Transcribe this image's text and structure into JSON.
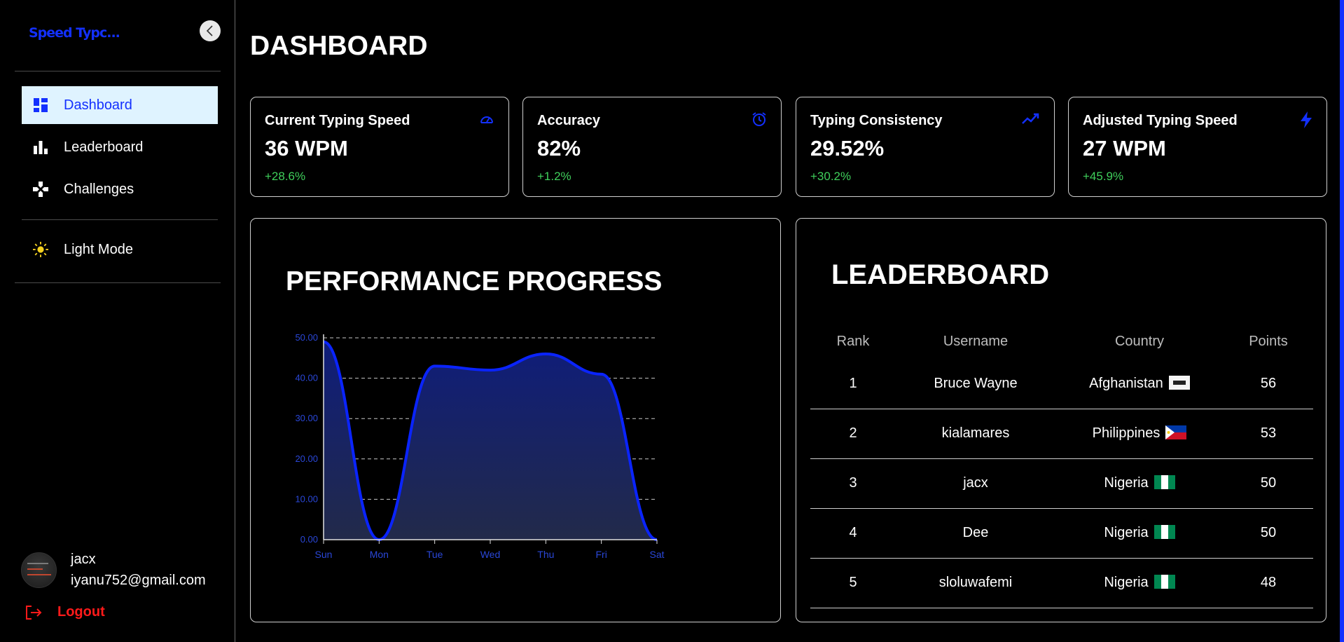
{
  "sidebar": {
    "brand": "Speed Typc...",
    "items": [
      {
        "label": "Dashboard",
        "icon": "dashboard-icon"
      },
      {
        "label": "Leaderboard",
        "icon": "bar-chart-icon"
      },
      {
        "label": "Challenges",
        "icon": "gamepad-icon"
      }
    ],
    "theme_toggle": "Light Mode",
    "user": {
      "name": "jacx",
      "email": "iyanu752@gmail.com"
    },
    "logout": "Logout"
  },
  "page_title": "DASHBOARD",
  "cards": [
    {
      "title": "Current Typing Speed",
      "value": "36 WPM",
      "delta": "+28.6%",
      "icon": "speedometer-icon"
    },
    {
      "title": "Accuracy",
      "value": "82%",
      "delta": "+1.2%",
      "icon": "alarm-clock-icon"
    },
    {
      "title": "Typing Consistency",
      "value": "29.52%",
      "delta": "+30.2%",
      "icon": "trending-up-icon"
    },
    {
      "title": "Adjusted Typing Speed",
      "value": "27 WPM",
      "delta": "+45.9%",
      "icon": "lightning-icon"
    }
  ],
  "performance": {
    "title": "PERFORMANCE PROGRESS"
  },
  "chart_data": {
    "type": "area",
    "categories": [
      "Sun",
      "Mon",
      "Tue",
      "Wed",
      "Thu",
      "Fri",
      "Sat"
    ],
    "values": [
      49,
      0,
      43,
      42,
      46,
      41,
      0
    ],
    "yticks": [
      "0.00",
      "10.00",
      "20.00",
      "30.00",
      "40.00",
      "50.00"
    ],
    "ylim": [
      0,
      50
    ],
    "grid": true,
    "line_color": "#0a24ff"
  },
  "leaderboard": {
    "title": "LEADERBOARD",
    "columns": [
      "Rank",
      "Username",
      "Country",
      "Points"
    ],
    "rows": [
      {
        "rank": "1",
        "username": "Bruce Wayne",
        "country": "Afghanistan",
        "flag": "afghanistan",
        "points": "56"
      },
      {
        "rank": "2",
        "username": "kialamares",
        "country": "Philippines",
        "flag": "philippines",
        "points": "53"
      },
      {
        "rank": "3",
        "username": "jacx",
        "country": "Nigeria",
        "flag": "nigeria",
        "points": "50"
      },
      {
        "rank": "4",
        "username": "Dee",
        "country": "Nigeria",
        "flag": "nigeria",
        "points": "50"
      },
      {
        "rank": "5",
        "username": "sloluwafemi",
        "country": "Nigeria",
        "flag": "nigeria",
        "points": "48"
      }
    ]
  },
  "colors": {
    "accent": "#1330ff",
    "positive": "#3fcf5b",
    "logout": "#ff1a1a"
  }
}
